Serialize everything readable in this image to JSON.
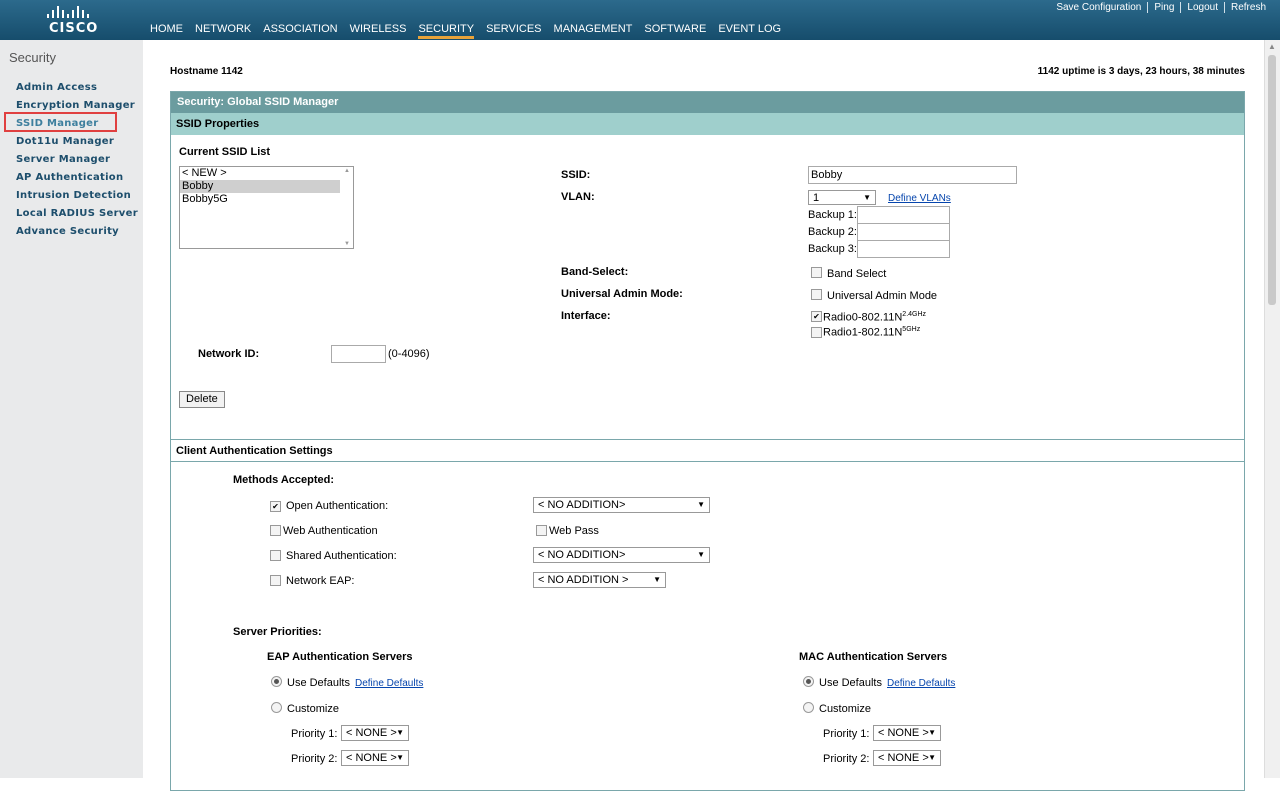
{
  "brand": {
    "logo": "CISCO"
  },
  "top_links": [
    "Save Configuration",
    "Ping",
    "Logout",
    "Refresh"
  ],
  "nav": [
    "HOME",
    "NETWORK",
    "ASSOCIATION",
    "WIRELESS",
    "SECURITY",
    "SERVICES",
    "MANAGEMENT",
    "SOFTWARE",
    "EVENT LOG"
  ],
  "nav_active": "SECURITY",
  "sidebar": {
    "title": "Security",
    "items": [
      "Admin Access",
      "Encryption Manager",
      "SSID Manager",
      "Dot11u Manager",
      "Server Manager",
      "AP Authentication",
      "Intrusion Detection",
      "Local RADIUS Server",
      "Advance Security"
    ],
    "active": "SSID Manager"
  },
  "header": {
    "hostname": "Hostname  1142",
    "uptime": "1142 uptime is 3 days, 23 hours, 38 minutes"
  },
  "panel": {
    "title": "Security: Global SSID Manager",
    "ssid_properties": "SSID Properties",
    "current_ssid_list_label": "Current SSID List",
    "ssid_list": [
      "< NEW >",
      "Bobby",
      "Bobby5G"
    ],
    "ssid_list_selected": "Bobby",
    "ssid_label": "SSID:",
    "ssid_value": "Bobby",
    "vlan_label": "VLAN:",
    "vlan_value": "1",
    "define_vlans": "Define VLANs",
    "backup1": "Backup 1:",
    "backup2": "Backup 2:",
    "backup3": "Backup 3:",
    "band_select_label": "Band-Select:",
    "band_select_cb": "Band Select",
    "uam_label": "Universal Admin Mode:",
    "uam_cb": "Universal Admin Mode",
    "interface_label": "Interface:",
    "radio0": "Radio0-802.11N",
    "radio0_sup": "2.4GHz",
    "radio1": "Radio1-802.11N",
    "radio1_sup": "5GHz",
    "network_id_label": "Network ID:",
    "network_id_hint": "(0-4096)",
    "delete_button": "Delete"
  },
  "client_auth": {
    "title": "Client Authentication Settings",
    "methods_label": "Methods Accepted:",
    "open_auth": "Open Authentication:",
    "open_auth_select": "< NO ADDITION>",
    "web_auth": "Web Authentication",
    "web_pass": "Web Pass",
    "shared_auth": "Shared Authentication:",
    "shared_auth_select": "< NO ADDITION>",
    "network_eap": "Network EAP:",
    "network_eap_select": "< NO ADDITION >",
    "server_priorities": "Server Priorities:",
    "eap_servers": "EAP Authentication Servers",
    "mac_servers": "MAC Authentication Servers",
    "use_defaults": "Use Defaults",
    "define_defaults": "Define Defaults",
    "customize": "Customize",
    "priority1": "Priority 1:",
    "priority2": "Priority 2:",
    "none_option": "< NONE >"
  }
}
